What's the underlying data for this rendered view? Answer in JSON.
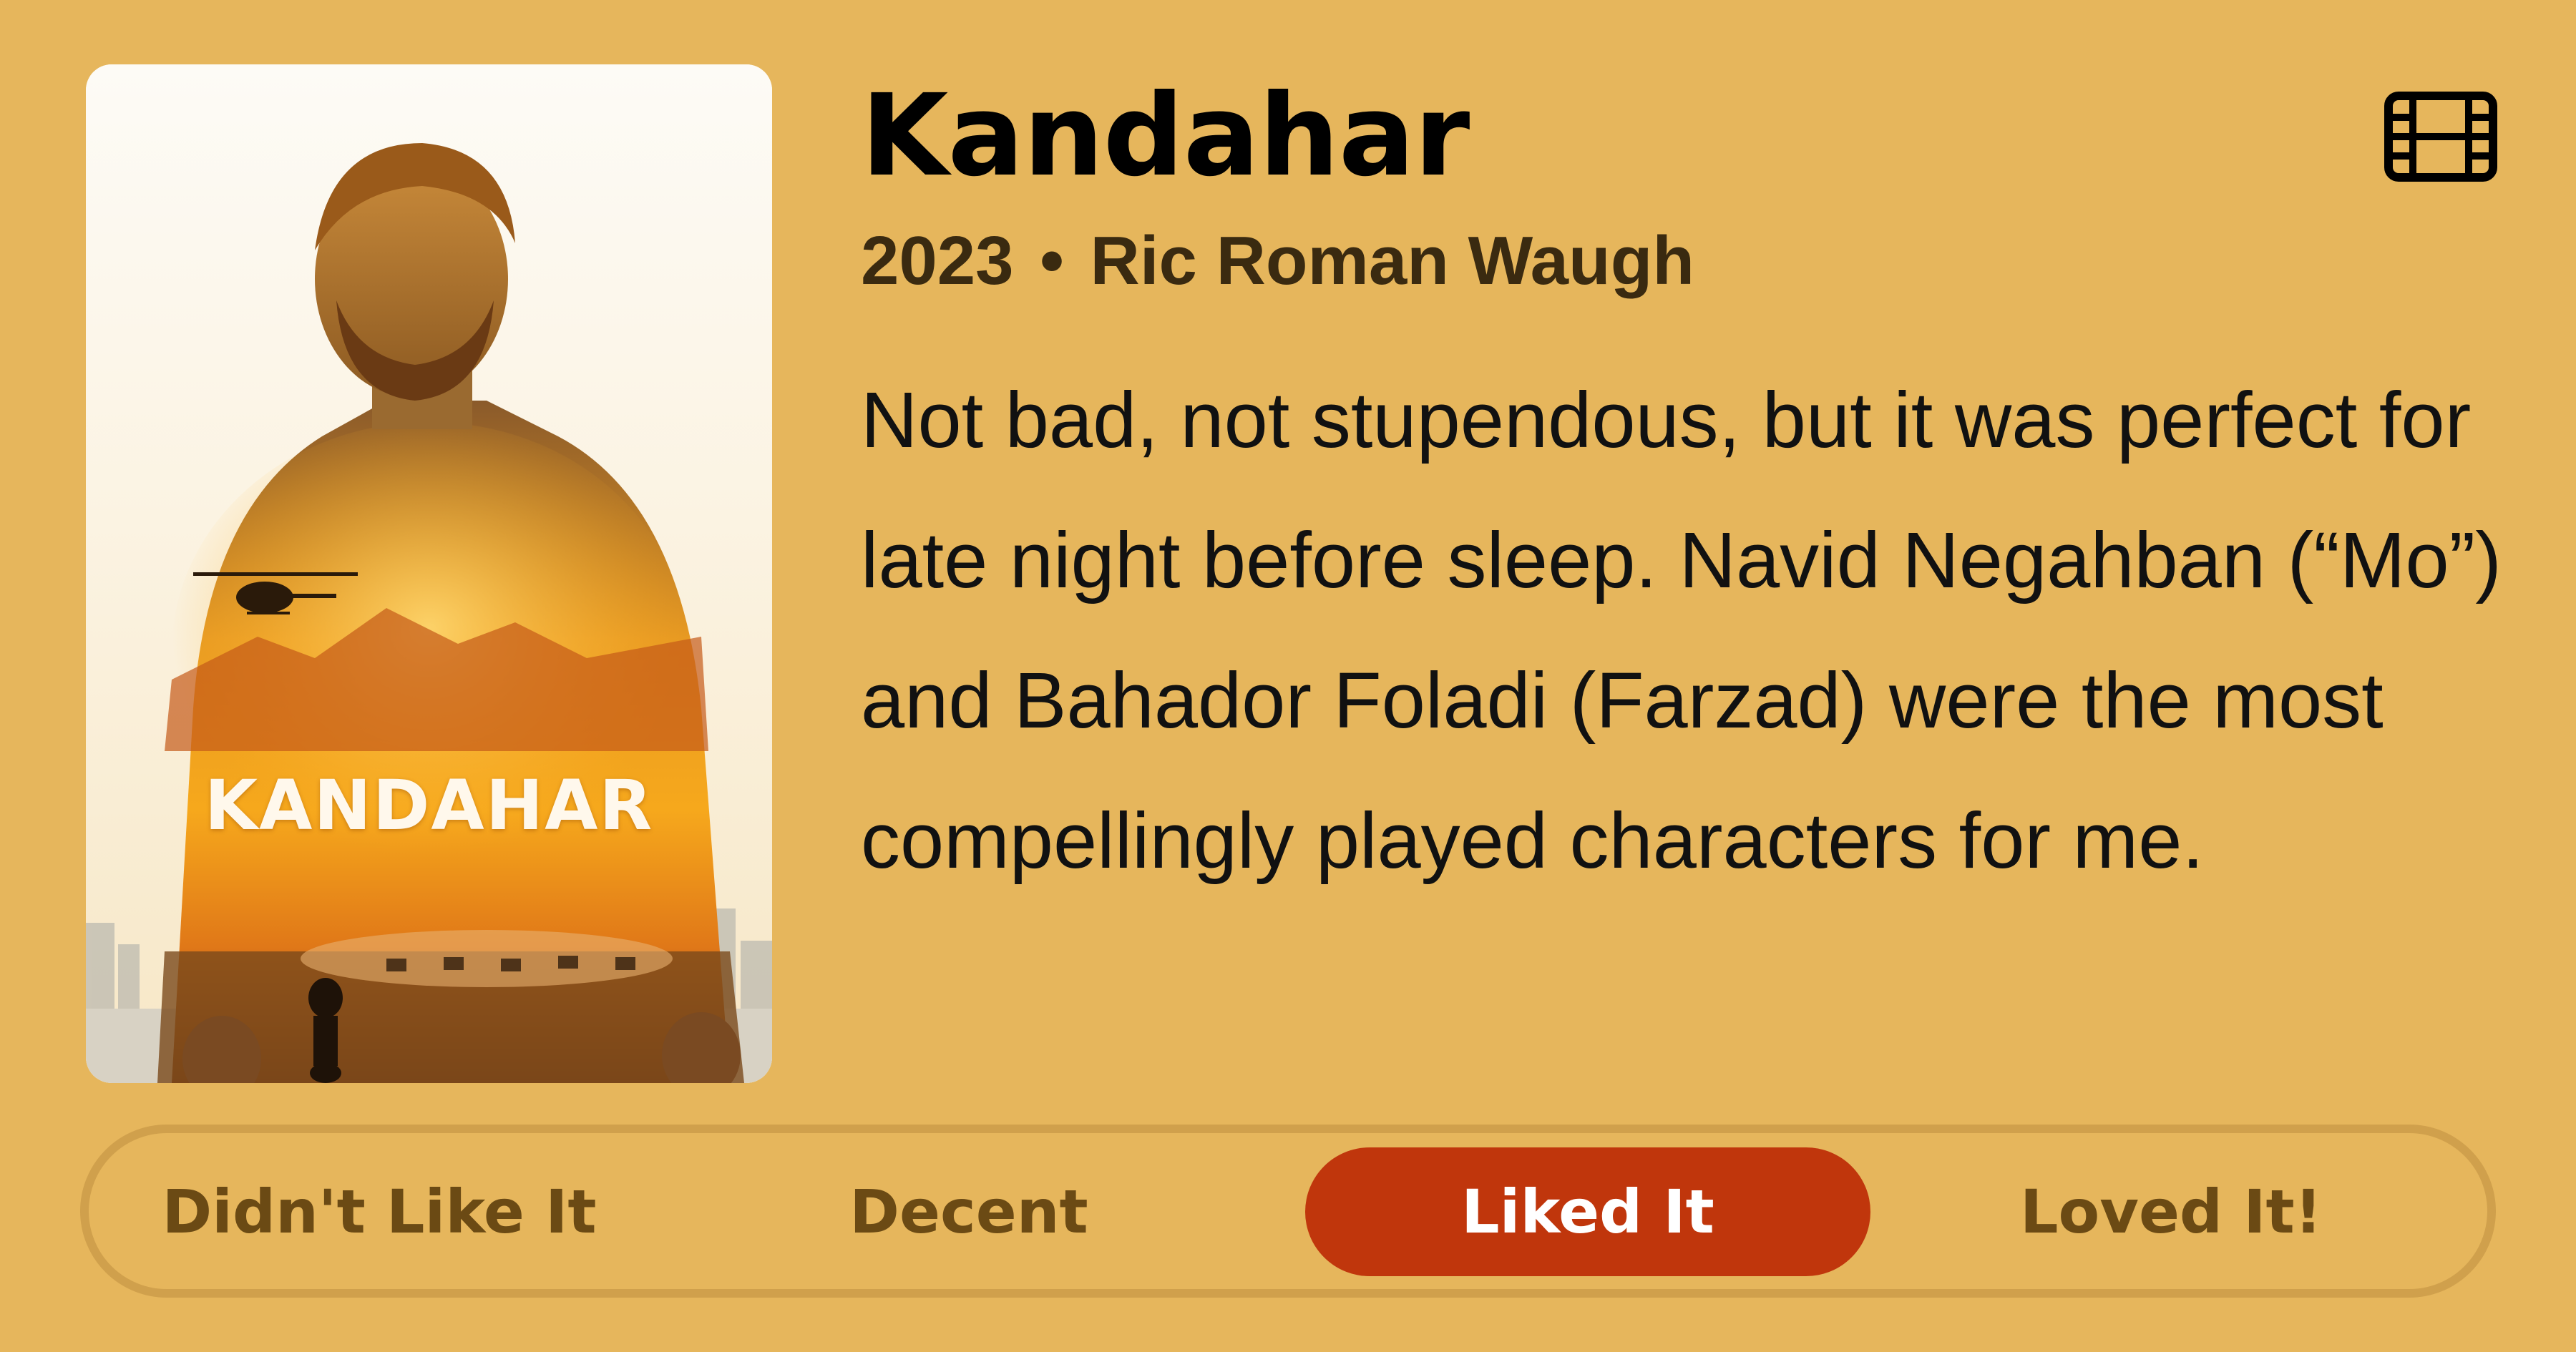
{
  "movie": {
    "title": "Kandahar",
    "year": "2023",
    "separator": "•",
    "director": "Ric Roman Waugh",
    "poster_title": "KANDAHAR",
    "type_icon": "film-strip-icon"
  },
  "review": {
    "text": "Not bad, not stupendous, but it was perfect for late night before sleep. Navid Negahban (“Mo”) and Bahador Foladi (Farzad) were the most compellingly played characters for me."
  },
  "rating": {
    "options": [
      "Didn't Like It",
      "Decent",
      "Liked It",
      "Loved It!"
    ],
    "selected": "Liked It"
  },
  "colors": {
    "background": "#e6b65c",
    "accent": "#c0360c",
    "option_text": "#6b4a14",
    "bar_border": "#d0a04c"
  }
}
